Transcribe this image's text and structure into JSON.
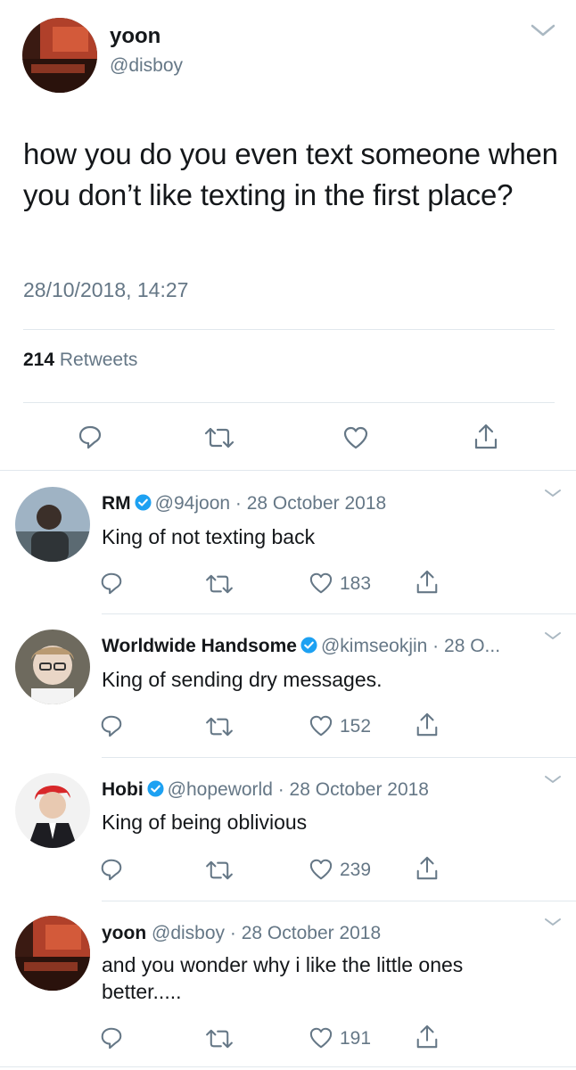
{
  "main_tweet": {
    "name": "yoon",
    "handle": "@disboy",
    "text": "how you do you even text someone when you don’t like texting in the first place?",
    "timestamp": "28/10/2018, 14:27",
    "retweet_count": "214",
    "retweet_label": "Retweets"
  },
  "replies": [
    {
      "name": "RM",
      "verified": true,
      "handle": "@94joon",
      "date": "28 October 2018",
      "text": "King of not texting back",
      "likes": "183"
    },
    {
      "name": "Worldwide Handsome",
      "verified": true,
      "handle": "@kimseokjin",
      "date": "28 O...",
      "text": "King of sending dry messages.",
      "likes": "152"
    },
    {
      "name": "Hobi",
      "verified": true,
      "handle": "@hopeworld",
      "date": "28 October 2018",
      "text": "King of being oblivious",
      "likes": "239"
    },
    {
      "name": "yoon",
      "verified": false,
      "handle": "@disboy",
      "date": "28 October 2018",
      "text": "and you wonder why i like the little ones better.....",
      "likes": "191"
    }
  ],
  "colors": {
    "text": "#14171a",
    "secondary": "#657786",
    "verified": "#1da1f2",
    "divider": "#e1e8ed"
  },
  "icons": [
    "reply-icon",
    "retweet-icon",
    "like-icon",
    "share-icon",
    "chevron-down-icon",
    "verified-badge-icon"
  ]
}
